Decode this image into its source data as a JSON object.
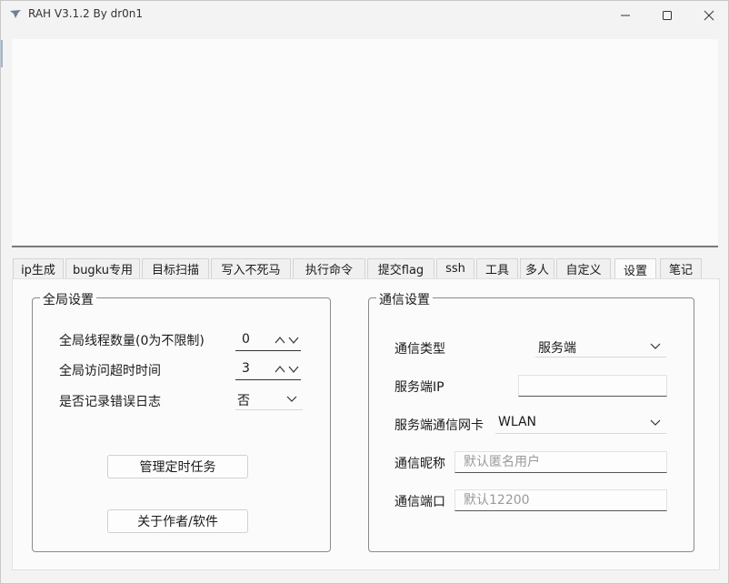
{
  "window": {
    "title": "RAH V3.1.2  By dr0n1"
  },
  "tabs": [
    {
      "label": "ip生成"
    },
    {
      "label": "bugku专用"
    },
    {
      "label": "目标扫描"
    },
    {
      "label": "写入不死马"
    },
    {
      "label": "执行命令"
    },
    {
      "label": "提交flag"
    },
    {
      "label": "ssh"
    },
    {
      "label": "工具"
    },
    {
      "label": "多人"
    },
    {
      "label": "自定义"
    },
    {
      "label": "设置",
      "active": true
    },
    {
      "label": "笔记"
    }
  ],
  "global": {
    "title": "全局设置",
    "threads_label": "全局线程数量(0为不限制)",
    "threads_value": "0",
    "timeout_label": "全局访问超时时间",
    "timeout_value": "3",
    "errlog_label": "是否记录错误日志",
    "errlog_value": "否",
    "schedule_button": "管理定时任务",
    "about_button": "关于作者/软件"
  },
  "comm": {
    "title": "通信设置",
    "type_label": "通信类型",
    "type_value": "服务端",
    "server_ip_label": "服务端IP",
    "server_ip_value": "",
    "nic_label": "服务端通信网卡",
    "nic_value": "WLAN",
    "nickname_label": "通信昵称",
    "nickname_placeholder": "默认匿名用户",
    "port_label": "通信端口",
    "port_placeholder": "默认12200"
  }
}
